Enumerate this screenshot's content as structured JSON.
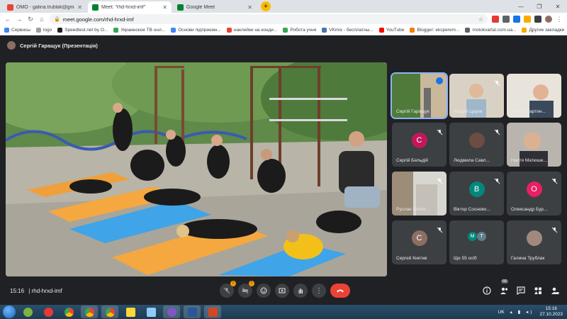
{
  "browser": {
    "tabs": [
      {
        "title": "ОМО - galina.trublak@gmail.com",
        "favicon_color": "#ea4335",
        "active": false
      },
      {
        "title": "Meet: \"rhd-hrxd-imf\"",
        "favicon_color": "#00832d",
        "active": true
      },
      {
        "title": "Google Meet",
        "favicon_color": "#00832d",
        "active": false
      }
    ],
    "new_tab": "+",
    "url": "meet.google.com/rhd-hrxd-imf",
    "bookmarks": [
      {
        "label": "Сервисы",
        "color": "#4285f4"
      },
      {
        "label": "logo",
        "color": "#9aa0a6"
      },
      {
        "label": "Speedtest.net by O...",
        "color": "#202124"
      },
      {
        "label": "Украинское ТВ онл...",
        "color": "#34a853"
      },
      {
        "label": "Основи підприємн...",
        "color": "#4285f4"
      },
      {
        "label": "наклейки на конди...",
        "color": "#ea4335"
      },
      {
        "label": "Робота учня",
        "color": "#34a853"
      },
      {
        "label": "VKmix - бесплатны...",
        "color": "#4a76a8"
      },
      {
        "label": "YouTube",
        "color": "#ff0000"
      },
      {
        "label": "Blogger: eksperem...",
        "color": "#f57c00"
      },
      {
        "label": "motokvartal.com.ua...",
        "color": "#5f6368"
      }
    ],
    "other_bookmarks": "Другие закладки"
  },
  "meet": {
    "presenter_label": "Сергій Гаращук (Презентація)",
    "participants": [
      {
        "name": "Сергій Гаращук",
        "type": "video",
        "speaking": true,
        "muted": false
      },
      {
        "name": "Андрій Царик",
        "type": "video",
        "speaking": false,
        "muted": true
      },
      {
        "name": "Віктор Мартин...",
        "type": "video",
        "speaking": false,
        "muted": false
      },
      {
        "name": "Сергій Бельдій",
        "type": "avatar",
        "initial": "С",
        "color": "#c2185b",
        "muted": true
      },
      {
        "name": "Людмила Савл...",
        "type": "avatar",
        "initial": "",
        "color": "#6d4c41",
        "muted": true
      },
      {
        "name": "Настя Матюше...",
        "type": "video",
        "speaking": false,
        "muted": false
      },
      {
        "name": "Руслан Оліни...",
        "type": "video",
        "speaking": false,
        "muted": true
      },
      {
        "name": "Віктор Сосново...",
        "type": "avatar",
        "initial": "В",
        "color": "#00897b",
        "muted": true
      },
      {
        "name": "Олександр Бур...",
        "type": "avatar",
        "initial": "О",
        "color": "#e91e63",
        "muted": true
      },
      {
        "name": "Сергей Киктев",
        "type": "avatar",
        "initial": "С",
        "color": "#8d6e63",
        "muted": true
      },
      {
        "name": "Ще 55 осіб",
        "type": "group",
        "initials": [
          "М",
          "Т"
        ],
        "muted": false
      },
      {
        "name": "Галина Трублак",
        "type": "avatar",
        "initial": "",
        "color": "#a1887f",
        "muted": true
      }
    ],
    "meeting_time": "15:16",
    "meeting_code": "rhd-hrxd-imf",
    "people_count": "66",
    "mic_warning": "!",
    "cam_warning": "!"
  },
  "taskbar": {
    "apps": [
      {
        "name": "explorer",
        "color": "#7cb342",
        "active": false
      },
      {
        "name": "kaspersky",
        "color": "#e53935",
        "active": false
      },
      {
        "name": "chrome",
        "color": "#fbbc04",
        "active": false
      },
      {
        "name": "chrome-2",
        "color": "#fbbc04",
        "active": true
      },
      {
        "name": "chrome-3",
        "color": "#fbbc04",
        "active": true
      },
      {
        "name": "folder",
        "color": "#fdd835",
        "active": false
      },
      {
        "name": "paint",
        "color": "#90caf9",
        "active": false
      },
      {
        "name": "viber",
        "color": "#7e57c2",
        "active": true
      },
      {
        "name": "word",
        "color": "#2b579a",
        "active": true
      },
      {
        "name": "powerpoint",
        "color": "#d24726",
        "active": true
      }
    ],
    "language": "UK",
    "time": "15:16",
    "date": "27.10.2023"
  }
}
